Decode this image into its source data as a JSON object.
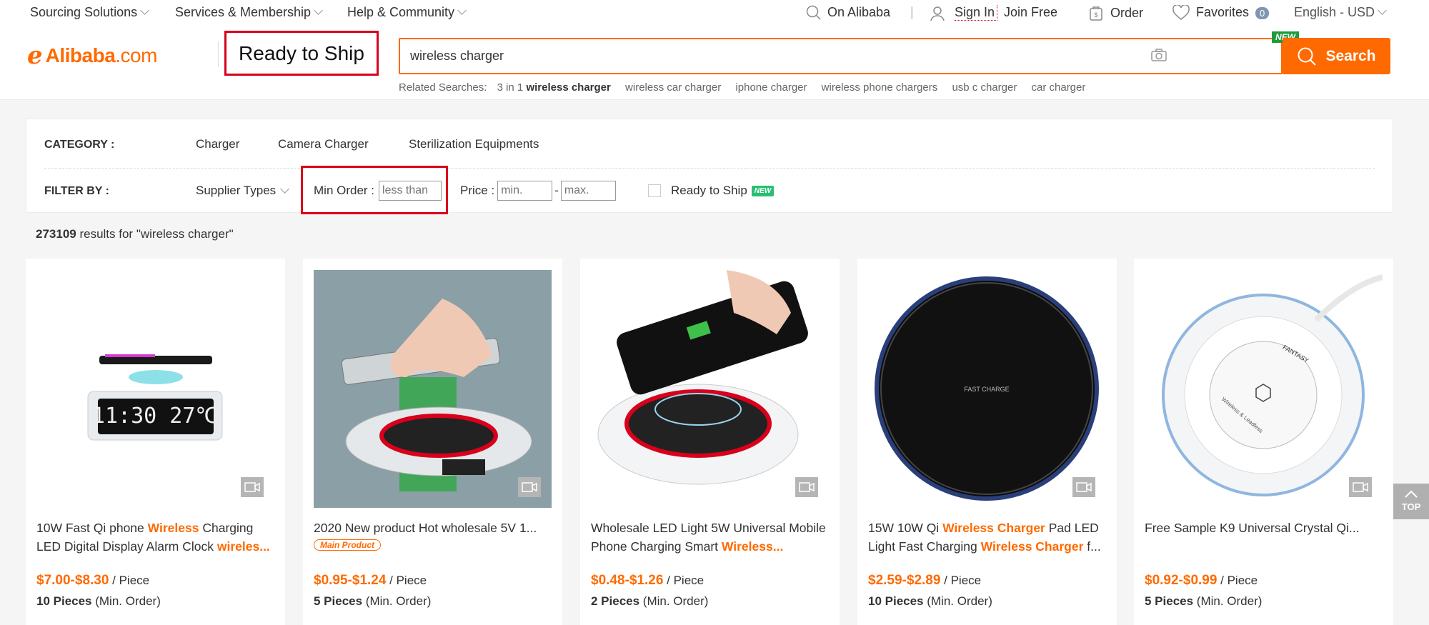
{
  "topnav": {
    "sourcing": "Sourcing Solutions",
    "services": "Services & Membership",
    "help": "Help & Community",
    "on_alibaba": "On Alibaba",
    "sign_in": "Sign In",
    "join_free": "Join Free",
    "order": "Order",
    "favorites": "Favorites",
    "favorites_count": "0",
    "language": "English - USD"
  },
  "brand": {
    "mark": "ℯ",
    "name": "Alibaba",
    "suffix": ".com"
  },
  "ready_to_ship_title": "Ready to Ship",
  "search": {
    "value": "wireless charger",
    "new_tag": "NEW",
    "button": "Search"
  },
  "related": {
    "label": "Related Searches:",
    "items": [
      {
        "pre": "3 in 1 ",
        "bold": "wireless charger"
      },
      {
        "pre": "wireless car charger",
        "bold": ""
      },
      {
        "pre": "iphone charger",
        "bold": ""
      },
      {
        "pre": "wireless phone chargers",
        "bold": ""
      },
      {
        "pre": "usb c charger",
        "bold": ""
      },
      {
        "pre": "car charger",
        "bold": ""
      }
    ]
  },
  "filters": {
    "category_label": "CATEGORY :",
    "categories": [
      "Charger",
      "Camera Charger",
      "Sterilization Equipments"
    ],
    "filter_label": "FILTER BY :",
    "supplier_types": "Supplier Types",
    "min_order_label": "Min Order :",
    "min_order_placeholder": "less than",
    "price_label": "Price :",
    "price_min_placeholder": "min.",
    "price_dash": "-",
    "price_max_placeholder": "max.",
    "ready_to_ship": "Ready to Ship",
    "new_badge": "NEW"
  },
  "results": {
    "count": "273109",
    "text": " results for \"wireless charger\""
  },
  "products": [
    {
      "t1": "10W Fast Qi phone ",
      "h1": "Wireless",
      "t2": " Charging LED Digital Display Alarm Clock ",
      "h2": "wireles...",
      "t3": "",
      "price": "$7.00-$8.30",
      "unit": " / Piece",
      "moq": "10 Pieces",
      "moq_suffix": " (Min. Order)"
    },
    {
      "t1": "2020 New product Hot wholesale 5V 1...",
      "h1": "",
      "t2": "",
      "h2": "",
      "t3": "",
      "main_product": "Main Product",
      "price": "$0.95-$1.24",
      "unit": " / Piece",
      "moq": "5 Pieces",
      "moq_suffix": " (Min. Order)"
    },
    {
      "t1": "Wholesale LED Light 5W Universal Mobile Phone Charging Smart ",
      "h1": "Wireless...",
      "t2": "",
      "h2": "",
      "t3": "",
      "price": "$0.48-$1.26",
      "unit": " / Piece",
      "moq": "2 Pieces",
      "moq_suffix": " (Min. Order)"
    },
    {
      "t1": "15W 10W Qi ",
      "h1": "Wireless Charger",
      "t2": " Pad LED Light Fast Charging ",
      "h2": "Wireless Charger",
      "t3": " f...",
      "price": "$2.59-$2.89",
      "unit": " / Piece",
      "moq": "10 Pieces",
      "moq_suffix": " (Min. Order)"
    },
    {
      "t1": "Free Sample K9 Universal Crystal Qi...",
      "h1": "",
      "t2": "",
      "h2": "",
      "t3": "",
      "price": "$0.92-$0.99",
      "unit": " / Piece",
      "moq": "5 Pieces",
      "moq_suffix": " (Min. Order)"
    }
  ],
  "images": {
    "clock_display": "11:30 27℃",
    "fast_charge": "FAST CHARGE",
    "fantasy": "FANTASY",
    "wireless_leadless": "Wireless & Leadless"
  },
  "top_button": "TOP",
  "colors": {
    "accent": "#ff6a00",
    "highlight_border": "#d9001b",
    "new_green": "#1f9b3b"
  }
}
